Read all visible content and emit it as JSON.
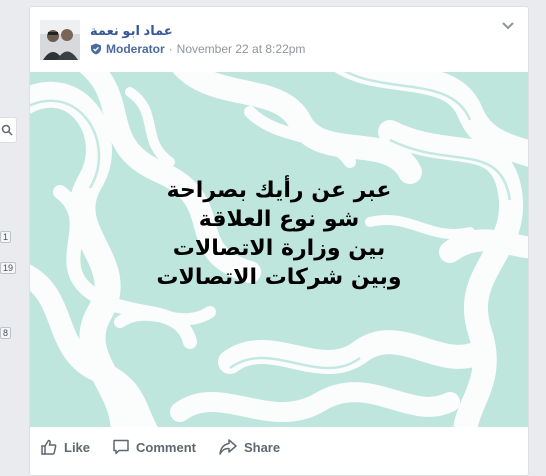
{
  "rail": {
    "badges": [
      "1",
      "19",
      "8"
    ]
  },
  "post": {
    "author": "عماد ابو نعمة",
    "role": "Moderator",
    "separator": "·",
    "timestamp": "November 22 at 8:22pm",
    "lines": [
      "عبر عن رأيك بصراحة",
      "شو نوع العلاقة",
      "بين وزارة الاتصالات",
      "وبين شركات الاتصالات"
    ],
    "background_colors": {
      "base": "#bfe6dd",
      "strokes": "#ffffff"
    }
  },
  "actions": {
    "like": "Like",
    "comment": "Comment",
    "share": "Share"
  },
  "colors": {
    "link": "#365899",
    "meta": "#90949c",
    "action": "#606770"
  }
}
